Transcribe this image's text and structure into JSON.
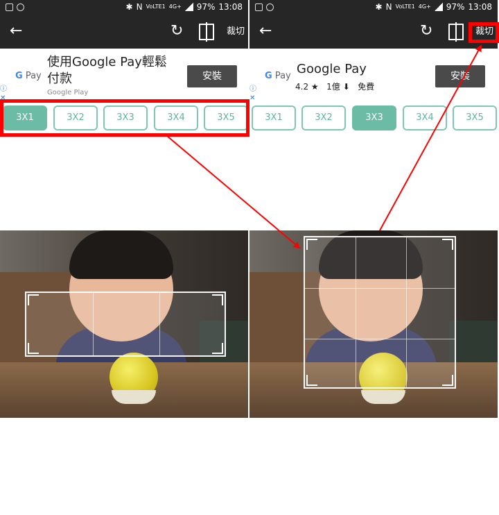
{
  "left": {
    "status": {
      "time": "13:08",
      "battery": "97%",
      "network": "4G+",
      "volte": "VoLTE1",
      "n": "N"
    },
    "toolbar": {
      "back_icon": "arrow-left-icon",
      "rotate_icon": "rotate-icon",
      "flip_icon": "flip-icon",
      "crop_label": "裁切"
    },
    "ad": {
      "brand": "Pay",
      "g": "G",
      "title": "使用Google Pay輕鬆付款",
      "subtitle": "Google Play",
      "install_label": "安裝",
      "info": "ⓘ",
      "close": "✕"
    },
    "ratios": [
      "3X1",
      "3X2",
      "3X3",
      "3X4",
      "3X5"
    ],
    "selected_ratio": "3X1",
    "grid": {
      "rows": 1,
      "cols": 3
    }
  },
  "right": {
    "status": {
      "time": "13:08",
      "battery": "97%",
      "network": "4G+",
      "volte": "VoLTE1",
      "n": "N"
    },
    "toolbar": {
      "back_icon": "arrow-left-icon",
      "rotate_icon": "rotate-icon",
      "flip_icon": "flip-icon",
      "crop_label": "裁切"
    },
    "ad": {
      "brand": "Pay",
      "g": "G",
      "title": "Google Pay",
      "rating": "4.2",
      "downloads": "1億",
      "price": "免費",
      "install_label": "安裝",
      "info": "ⓘ",
      "close": "✕"
    },
    "ratios": [
      "3X1",
      "3X2",
      "3X3",
      "3X4",
      "3X5"
    ],
    "selected_ratio": "3X3",
    "grid": {
      "rows": 3,
      "cols": 3
    }
  },
  "colors": {
    "accent": "#6bbba5",
    "highlight": "#ff0000",
    "toolbar": "#262626"
  }
}
